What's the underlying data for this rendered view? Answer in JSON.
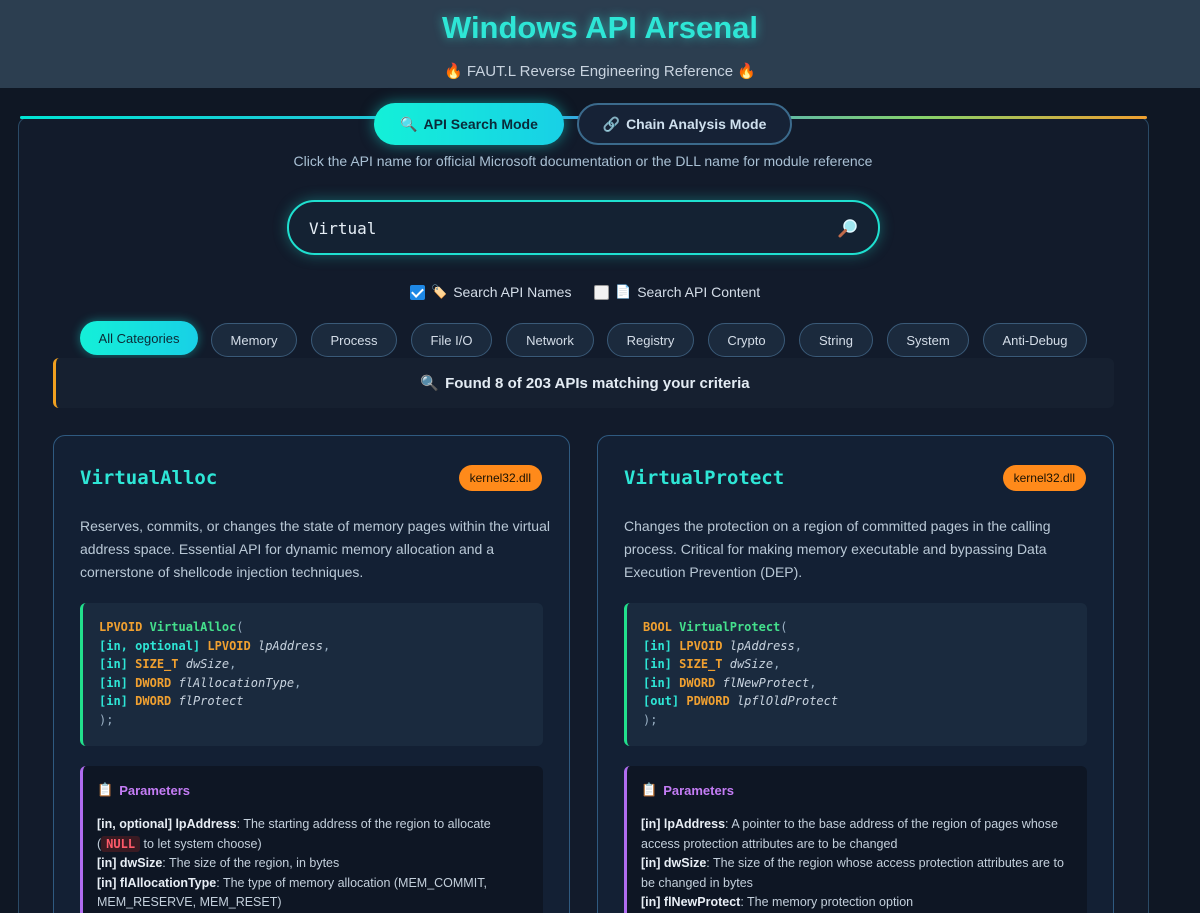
{
  "header": {
    "title": "Windows API Arsenal",
    "subtitle": "FAUT.L Reverse Engineering Reference"
  },
  "modes": {
    "search_label": "API Search Mode",
    "chain_label": "Chain Analysis Mode"
  },
  "hint": "Click the API name for official Microsoft documentation or the DLL name for module reference",
  "search": {
    "value": "Virtual",
    "placeholder": ""
  },
  "filters": {
    "names_label": "Search API Names",
    "names_checked": true,
    "content_label": "Search API Content",
    "content_checked": false
  },
  "categories": [
    "All Categories",
    "Memory",
    "Process",
    "File I/O",
    "Network",
    "Registry",
    "Crypto",
    "String",
    "System",
    "Anti-Debug"
  ],
  "results": {
    "text": "Found 8 of 203 APIs matching your criteria"
  },
  "cards": [
    {
      "name": "VirtualAlloc",
      "dll": "kernel32.dll",
      "description": "Reserves, commits, or changes the state of memory pages within the virtual address space. Essential API for dynamic memory allocation and a cornerstone of shellcode injection techniques.",
      "signature": {
        "return_type": "LPVOID",
        "function": "VirtualAlloc",
        "params": [
          {
            "ann": "[in, optional]",
            "type": "LPVOID",
            "name": "lpAddress",
            "sep": ","
          },
          {
            "ann": "[in]",
            "type": "SIZE_T",
            "name": "dwSize",
            "sep": ","
          },
          {
            "ann": "[in]",
            "type": "DWORD",
            "name": "flAllocationType",
            "sep": ","
          },
          {
            "ann": "[in]",
            "type": "DWORD",
            "name": "flProtect",
            "sep": ""
          }
        ]
      },
      "params_title": "Parameters",
      "param_docs": [
        {
          "label": "[in, optional] lpAddress",
          "text": "The starting address of the region to allocate (",
          "badge": "NULL",
          "after": " to let system choose)"
        },
        {
          "label": "[in] dwSize",
          "text": "The size of the region, in bytes"
        },
        {
          "label": "[in] flAllocationType",
          "text": "The type of memory allocation (MEM_COMMIT, MEM_RESERVE, MEM_RESET)"
        }
      ]
    },
    {
      "name": "VirtualProtect",
      "dll": "kernel32.dll",
      "description": "Changes the protection on a region of committed pages in the calling process. Critical for making memory executable and bypassing Data Execution Prevention (DEP).",
      "signature": {
        "return_type": "BOOL",
        "function": "VirtualProtect",
        "params": [
          {
            "ann": "[in]",
            "type": "LPVOID",
            "name": "lpAddress",
            "sep": ","
          },
          {
            "ann": "[in]",
            "type": "SIZE_T",
            "name": "dwSize",
            "sep": ","
          },
          {
            "ann": "[in]",
            "type": "DWORD",
            "name": "flNewProtect",
            "sep": ","
          },
          {
            "ann": "[out]",
            "type": "PDWORD",
            "name": "lpflOldProtect",
            "sep": ""
          }
        ]
      },
      "params_title": "Parameters",
      "param_docs": [
        {
          "label": "[in] lpAddress",
          "text": "A pointer to the base address of the region of pages whose access protection attributes are to be changed"
        },
        {
          "label": "[in] dwSize",
          "text": "The size of the region whose access protection attributes are to be changed in bytes"
        },
        {
          "label": "[in] flNewProtect",
          "text": "The memory protection option"
        }
      ]
    }
  ],
  "colors": {
    "accent": "#2ee6d6",
    "dll_badge": "#ff8a1a",
    "code_border": "#22e08c",
    "params_border": "#b06cf0",
    "results_border": "#f0a020"
  },
  "icons": {
    "flame": "fire-icon",
    "search_mode": "magnifier-icon",
    "chain_mode": "link-icon",
    "search_box": "magnifier-icon",
    "names": "label-icon",
    "content": "document-icon",
    "results": "magnifier-icon",
    "params": "clipboard-icon"
  }
}
